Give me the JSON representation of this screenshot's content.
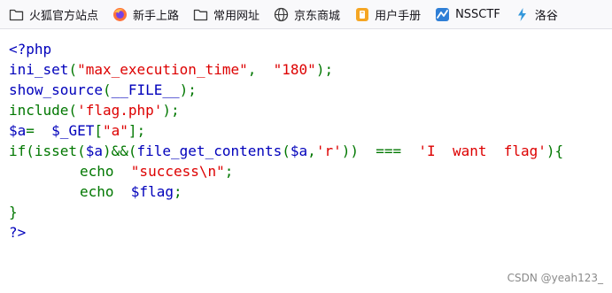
{
  "bookmarks": [
    {
      "icon": "folder-icon",
      "label": "火狐官方站点"
    },
    {
      "icon": "firefox-icon",
      "label": "新手上路"
    },
    {
      "icon": "folder-icon",
      "label": "常用网址"
    },
    {
      "icon": "globe-icon",
      "label": "京东商城"
    },
    {
      "icon": "manual-icon",
      "label": "用户手册"
    },
    {
      "icon": "nssctf-icon",
      "label": "NSSCTF"
    },
    {
      "icon": "bolt-icon",
      "label": "洛谷"
    }
  ],
  "code": {
    "l1": "<?php",
    "l2": {
      "a": "ini_set",
      "b": "(",
      "c": "\"max_execution_time\"",
      "d": ",  ",
      "e": "\"180\"",
      "f": ");"
    },
    "l3": {
      "a": "show_source",
      "b": "(",
      "c": "__FILE__",
      "d": ");"
    },
    "l4": {
      "a": "include(",
      "b": "'flag.php'",
      "c": ");"
    },
    "l5": {
      "a": "$a",
      "b": "=  ",
      "c": "$_GET",
      "d": "[",
      "e": "\"a\"",
      "f": "];"
    },
    "l6": {
      "a": "if(isset(",
      "b": "$a",
      "c": ")&&(",
      "d": "file_get_contents",
      "e": "(",
      "f": "$a",
      "g": ",",
      "h": "'r'",
      "i": "))  ===  ",
      "j": "'I  want  flag'",
      "k": "){"
    },
    "l7": {
      "a": "echo  ",
      "b": "\"success\\n\"",
      "c": ";"
    },
    "l8": {
      "a": "echo  ",
      "b": "$flag",
      "c": ";"
    },
    "l9": "}",
    "l10": "?>"
  },
  "watermark": "CSDN @yeah123_",
  "colors": {
    "default": "#0000bb",
    "keyword": "#007700",
    "string": "#dd0000"
  }
}
